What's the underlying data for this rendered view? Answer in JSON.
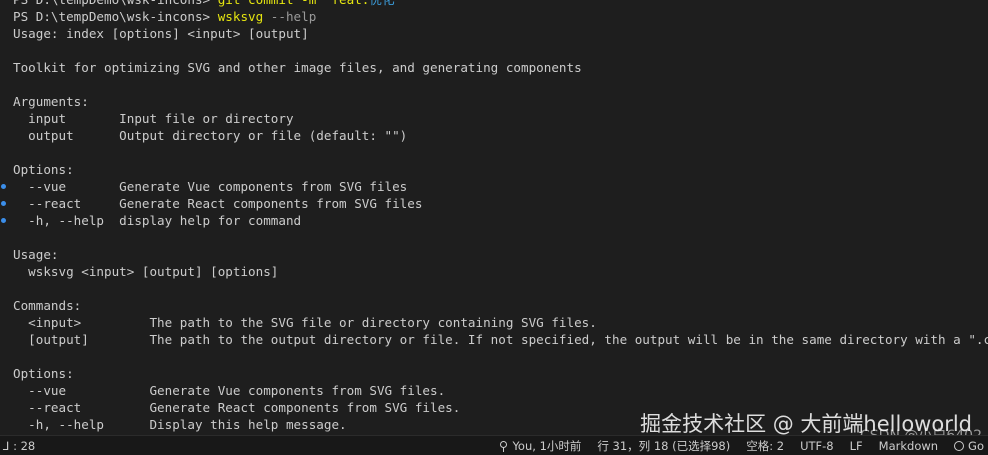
{
  "terminal": {
    "lines": [
      {
        "segments": [
          {
            "text": "PS D:\\tempDemo\\wsk-incons> ",
            "style": "normal"
          },
          {
            "text": "git commit -m \"feat:",
            "style": "yellow"
          },
          {
            "text": "优化",
            "style": "cjk"
          }
        ],
        "marker": false
      },
      {
        "segments": [
          {
            "text": "PS D:\\tempDemo\\wsk-incons> ",
            "style": "normal"
          },
          {
            "text": "wsksvg",
            "style": "yellow"
          },
          {
            "text": " --help",
            "style": "gray"
          }
        ],
        "marker": false
      },
      {
        "segments": [
          {
            "text": "Usage: index [options] <input> [output]",
            "style": "normal"
          }
        ],
        "marker": false
      },
      {
        "segments": [
          {
            "text": "",
            "style": "normal"
          }
        ],
        "marker": false
      },
      {
        "segments": [
          {
            "text": "Toolkit for optimizing SVG and other image files, and generating components",
            "style": "normal"
          }
        ],
        "marker": false
      },
      {
        "segments": [
          {
            "text": "",
            "style": "normal"
          }
        ],
        "marker": false
      },
      {
        "segments": [
          {
            "text": "Arguments:",
            "style": "normal"
          }
        ],
        "marker": false
      },
      {
        "segments": [
          {
            "text": "  input       Input file or directory",
            "style": "normal"
          }
        ],
        "marker": false
      },
      {
        "segments": [
          {
            "text": "  output      Output directory or file (default: \"\")",
            "style": "normal"
          }
        ],
        "marker": false
      },
      {
        "segments": [
          {
            "text": "",
            "style": "normal"
          }
        ],
        "marker": false
      },
      {
        "segments": [
          {
            "text": "Options:",
            "style": "normal"
          }
        ],
        "marker": false
      },
      {
        "segments": [
          {
            "text": "  --vue       Generate Vue components from SVG files",
            "style": "normal"
          }
        ],
        "marker": true
      },
      {
        "segments": [
          {
            "text": "  --react     Generate React components from SVG files",
            "style": "normal"
          }
        ],
        "marker": true
      },
      {
        "segments": [
          {
            "text": "  -h, --help  display help for command",
            "style": "normal"
          }
        ],
        "marker": true
      },
      {
        "segments": [
          {
            "text": "",
            "style": "normal"
          }
        ],
        "marker": false
      },
      {
        "segments": [
          {
            "text": "Usage:",
            "style": "normal"
          }
        ],
        "marker": false
      },
      {
        "segments": [
          {
            "text": "  wsksvg <input> [output] [options]",
            "style": "normal"
          }
        ],
        "marker": false
      },
      {
        "segments": [
          {
            "text": "",
            "style": "normal"
          }
        ],
        "marker": false
      },
      {
        "segments": [
          {
            "text": "Commands:",
            "style": "normal"
          }
        ],
        "marker": false
      },
      {
        "segments": [
          {
            "text": "  <input>         The path to the SVG file or directory containing SVG files.",
            "style": "normal"
          }
        ],
        "marker": false
      },
      {
        "segments": [
          {
            "text": "  [output]        The path to the output directory or file. If not specified, the output will be in the same directory with a \".copy\" suffix.",
            "style": "normal"
          }
        ],
        "marker": false
      },
      {
        "segments": [
          {
            "text": "",
            "style": "normal"
          }
        ],
        "marker": false
      },
      {
        "segments": [
          {
            "text": "Options:",
            "style": "normal"
          }
        ],
        "marker": false
      },
      {
        "segments": [
          {
            "text": "  --vue           Generate Vue components from SVG files.",
            "style": "normal"
          }
        ],
        "marker": false
      },
      {
        "segments": [
          {
            "text": "  --react         Generate React components from SVG files.",
            "style": "normal"
          }
        ],
        "marker": false
      },
      {
        "segments": [
          {
            "text": "  -h, --help      Display this help message.",
            "style": "normal"
          }
        ],
        "marker": false
      }
    ]
  },
  "watermark": {
    "primary": "掘金技术社区 @ 大前端helloworld",
    "secondary": "CSDN @小白6402"
  },
  "statusbar": {
    "left": "⅃ : 28",
    "blame": "You, 1小时前",
    "position": "行 31，列 18 (已选择98)",
    "indent": "空格: 2",
    "encoding": "UTF-8",
    "eol": "LF",
    "language": "Markdown",
    "extra": "Go"
  },
  "colors": {
    "background": "#1e1e1e",
    "text": "#cccccc",
    "command": "#e5e510",
    "marker": "#3b8eea"
  }
}
